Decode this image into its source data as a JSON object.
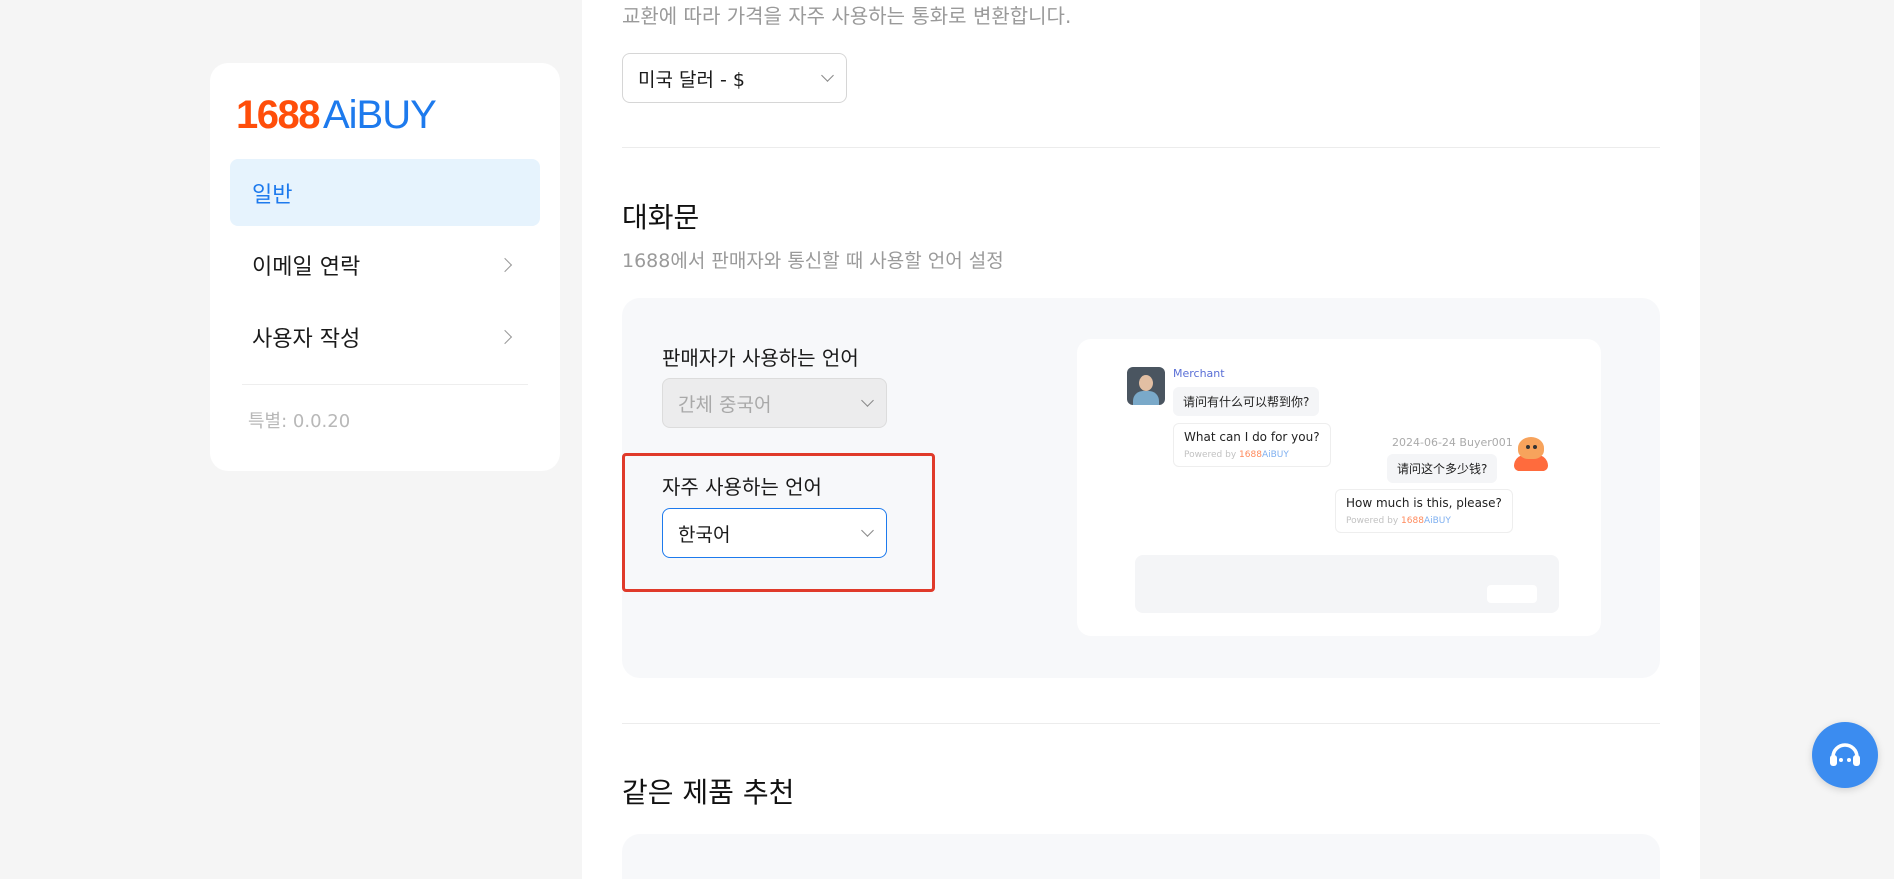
{
  "sidebar": {
    "logo": {
      "numeral": "1688",
      "brand": "AiBUY"
    },
    "items": [
      {
        "label": "일반",
        "active": true
      },
      {
        "label": "이메일 연락",
        "active": false
      },
      {
        "label": "사용자 작성",
        "active": false
      }
    ],
    "version": "특별: 0.0.20"
  },
  "currency_section": {
    "description": "교환에 따라 가격을 자주 사용하는 통화로 변환합니다.",
    "selected": "미국 달러 - $"
  },
  "conversation_section": {
    "title": "대화문",
    "description": "1688에서 판매자와 통신할 때 사용할 언어 설정",
    "seller_language_label": "판매자가 사용하는 언어",
    "seller_language_value": "간체 중국어",
    "frequent_language_label": "자주 사용하는 언어",
    "frequent_language_value": "한국어",
    "preview": {
      "merchant_name": "Merchant",
      "merchant_msg_zh": "请问有什么可以帮到你?",
      "merchant_msg_en": "What can I do for you?",
      "powered_by": "Powered by",
      "powered_num": "1688",
      "powered_brand": "AiBUY",
      "buyer_meta": "2024-06-24 Buyer001",
      "buyer_msg_zh": "请问这个多少钱?",
      "buyer_msg_en": "How much is this, please?"
    }
  },
  "recommend_section": {
    "title": "같은 제품 추천"
  },
  "colors": {
    "accent": "#1d7aed",
    "brand_orange": "#ff4e0a",
    "highlight_red": "#e03a2a"
  }
}
